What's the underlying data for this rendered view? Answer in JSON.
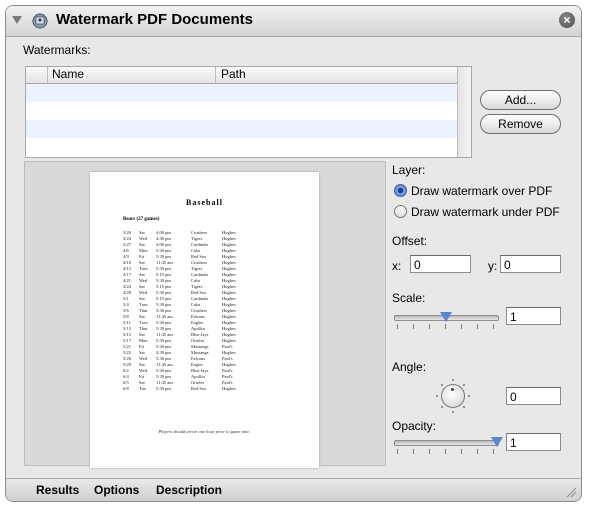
{
  "window": {
    "title": "Watermark PDF Documents",
    "close_glyph": "×"
  },
  "watermarks": {
    "label": "Watermarks:",
    "columns": {
      "name": "Name",
      "path": "Path"
    },
    "add_label": "Add...",
    "remove_label": "Remove"
  },
  "preview_page": {
    "title": "Baseball",
    "subtitle": "Bears (27 games)",
    "rows": [
      [
        "3/20",
        "Sat",
        "4:00 pm",
        "Crushers",
        "Hughes"
      ],
      [
        "3/24",
        "Wed",
        "4:30 pm",
        "Tigers",
        "Hughes"
      ],
      [
        "3/27",
        "Sat",
        "2:00 pm",
        "Cardinals",
        "Hughes"
      ],
      [
        "4/6",
        "Mon",
        "5:30 pm",
        "Cubs",
        "Hughes"
      ],
      [
        "4/9",
        "Fri",
        "5:30 pm",
        "Red Sox",
        "Hughes"
      ],
      [
        "4/10",
        "Sat",
        "11:45 am",
        "Crushers",
        "Hughes"
      ],
      [
        "4/13",
        "Tues",
        "5:30 pm",
        "Tigers",
        "Hughes"
      ],
      [
        "4/17",
        "Sat",
        "5:15 pm",
        "Cardinals",
        "Hughes"
      ],
      [
        "4/21",
        "Wed",
        "5:30 pm",
        "Cubs",
        "Hughes"
      ],
      [
        "4/24",
        "Sat",
        "5:15 pm",
        "Tigers",
        "Hughes"
      ],
      [
        "4/28",
        "Wed",
        "5:30 pm",
        "Red Sox",
        "Hughes"
      ],
      [
        "5/1",
        "Sat",
        "5:15 pm",
        "Cardinals",
        "Hughes"
      ],
      [
        "5/4",
        "Tues",
        "5:30 pm",
        "Cubs",
        "Hughes"
      ],
      [
        "5/6",
        "Thur",
        "5:30 pm",
        "Crushers",
        "Hughes"
      ],
      [
        "5/8",
        "Sat",
        "11:45 am",
        "Falcons",
        "Hughes"
      ],
      [
        "5/11",
        "Tues",
        "5:30 pm",
        "Eagles",
        "Hughes"
      ],
      [
        "5/13",
        "Thur",
        "5:30 pm",
        "Apollos",
        "Hughes"
      ],
      [
        "5/15",
        "Sat",
        "11:45 am",
        "Blue Jays",
        "Hughes"
      ],
      [
        "5/17",
        "Mon",
        "5:30 pm",
        "Orioles",
        "Hughes"
      ],
      [
        "5/21",
        "Fri",
        "5:30 pm",
        "Mustangs",
        "Paul's"
      ],
      [
        "5/22",
        "Sat",
        "2:30 pm",
        "Mustangs",
        "Hughes"
      ],
      [
        "5/26",
        "Wed",
        "5:30 pm",
        "Falcons",
        "Paul's"
      ],
      [
        "5/29",
        "Sat",
        "11:45 am",
        "Eagles",
        "Hughes"
      ],
      [
        "6/2",
        "Wed",
        "5:30 pm",
        "Blue Jays",
        "Paul's"
      ],
      [
        "6/4",
        "Fri",
        "5:30 pm",
        "Apollos",
        "Paul's"
      ],
      [
        "6/5",
        "Sat",
        "11:45 am",
        "Orioles",
        "Paul's"
      ],
      [
        "6/8",
        "Tue",
        "5:30 pm",
        "Red Sox",
        "Hughes"
      ]
    ],
    "note": "Players should arrive one hour prior to game time."
  },
  "layer": {
    "label": "Layer:",
    "options": [
      "Draw watermark over PDF",
      "Draw watermark under PDF"
    ],
    "selected_index": 0
  },
  "offset": {
    "label": "Offset:",
    "x_label": "x:",
    "x_value": "0",
    "y_label": "y:",
    "y_value": "0"
  },
  "scale": {
    "label": "Scale:",
    "value": "1",
    "slider_fraction": 0.5
  },
  "angle": {
    "label": "Angle:",
    "value": "0"
  },
  "opacity": {
    "label": "Opacity:",
    "value": "1",
    "slider_fraction": 1.0
  },
  "bottom_tabs": [
    "Results",
    "Options",
    "Description"
  ],
  "colors": {
    "accent": "#5b84d1",
    "row_alt": "#edf3fe"
  }
}
